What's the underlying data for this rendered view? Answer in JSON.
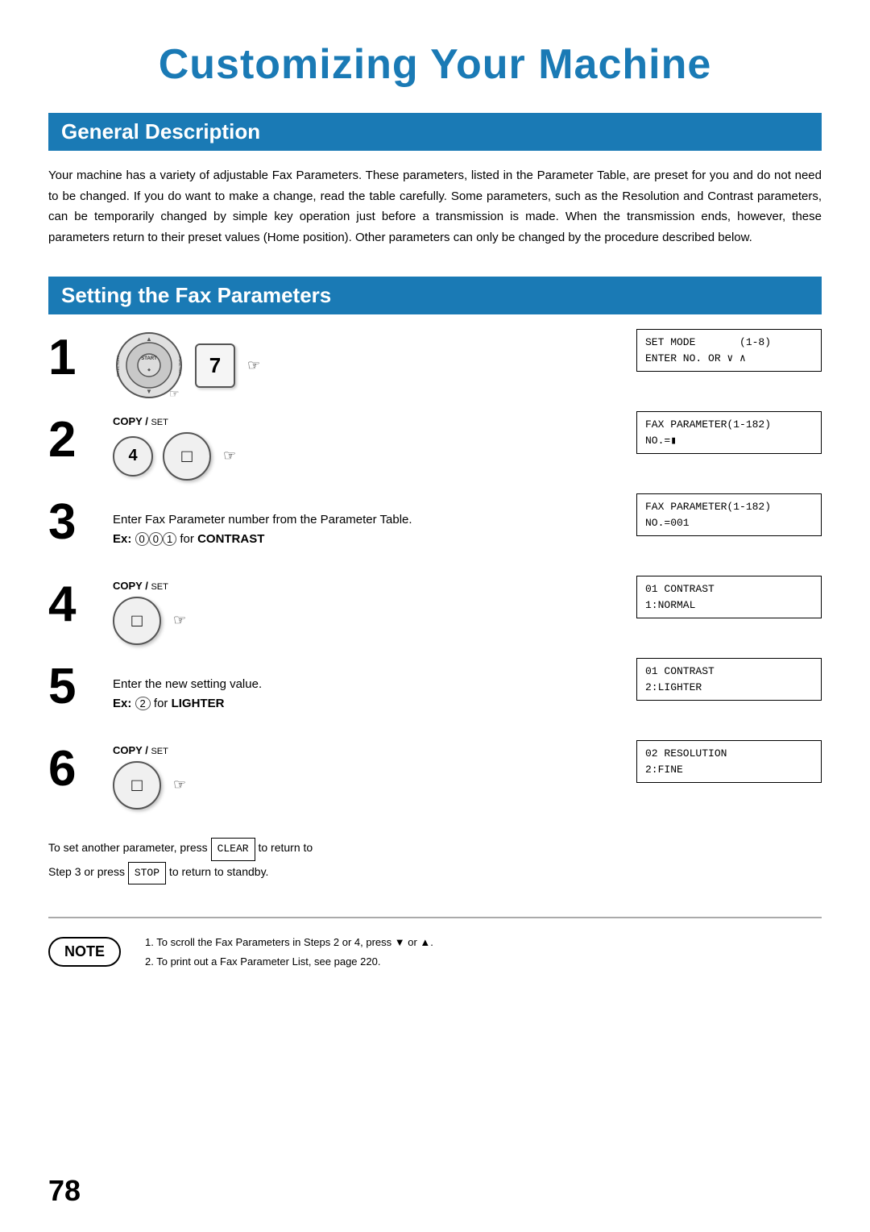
{
  "page": {
    "title": "Customizing Your Machine",
    "number": "78"
  },
  "sections": {
    "general": {
      "header": "General Description",
      "body": "Your machine has a variety of adjustable Fax Parameters. These parameters, listed in the Parameter Table, are preset for you and do not need to be changed. If you do want to make a change, read the table carefully. Some parameters, such as the Resolution and Contrast parameters, can be temporarily changed by simple key operation just before a transmission is made. When the transmission ends, however, these parameters return to their preset values (Home position). Other parameters can only be changed by the procedure described below."
    },
    "fax_params": {
      "header": "Setting the  Fax Parameters",
      "steps": [
        {
          "number": "1",
          "icon_type": "dial_and_7",
          "display": [
            "SET MODE       (1-8)",
            "ENTER NO. OR ∨ ∧"
          ]
        },
        {
          "number": "2",
          "icon_type": "4_and_copy",
          "label": "COPY / SET",
          "display": [
            "FAX PARAMETER(1-182)",
            "NO.=■"
          ]
        },
        {
          "number": "3",
          "icon_type": "text_only",
          "text": "Enter Fax Parameter number from the Parameter Table.",
          "ex": "Ex: ⓪⓪① for CONTRAST",
          "display": [
            "FAX PARAMETER(1-182)",
            "NO.=001"
          ]
        },
        {
          "number": "4",
          "icon_type": "copy_only",
          "label": "COPY / SET",
          "display": [
            "01 CONTRAST",
            "1:NORMAL"
          ]
        },
        {
          "number": "5",
          "icon_type": "text_only",
          "text": "Enter the new setting value.",
          "ex": "Ex: ② for LIGHTER",
          "display": [
            "01 CONTRAST",
            "2:LIGHTER"
          ]
        },
        {
          "number": "6",
          "icon_type": "copy_only",
          "label": "COPY / SET",
          "display": [
            "02 RESOLUTION",
            "2:FINE"
          ]
        }
      ],
      "return_text_1": "To set another parameter, press ",
      "return_key_1": "CLEAR",
      "return_text_2": " to return to",
      "return_text_3": "Step 3 or press ",
      "return_key_2": "STOP",
      "return_text_4": " to return to standby."
    }
  },
  "note": {
    "label": "NOTE",
    "items": [
      "1.  To scroll the Fax Parameters in Steps 2 or 4, press ▼ or ▲.",
      "2.  To print out a Fax Parameter List, see page 220."
    ]
  }
}
